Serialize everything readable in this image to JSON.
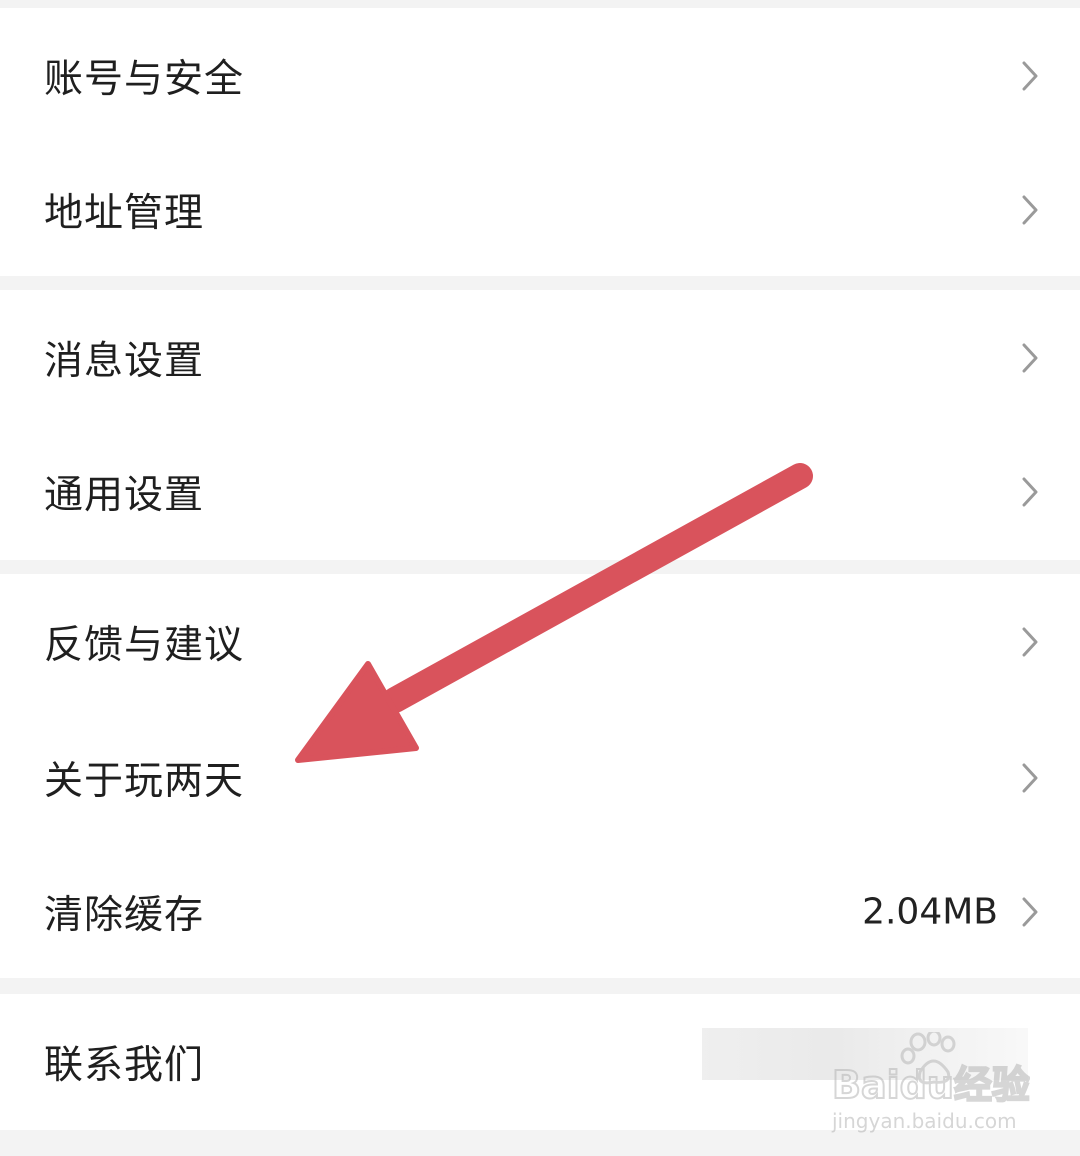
{
  "settings": {
    "groups": [
      {
        "items": [
          {
            "label": "账号与安全",
            "value": ""
          },
          {
            "label": "地址管理",
            "value": ""
          }
        ]
      },
      {
        "items": [
          {
            "label": "消息设置",
            "value": ""
          },
          {
            "label": "通用设置",
            "value": ""
          }
        ]
      },
      {
        "items": [
          {
            "label": "反馈与建议",
            "value": ""
          },
          {
            "label": "关于玩两天",
            "value": ""
          },
          {
            "label": "清除缓存",
            "value": "2.04MB"
          }
        ]
      },
      {
        "items": [
          {
            "label": "联系我们",
            "value": ""
          }
        ]
      }
    ]
  },
  "annotation": {
    "color": "#d9535c",
    "points_to": "关于玩两天"
  },
  "watermark": {
    "brand": "Baidu经验",
    "url": "jingyan.baidu.com"
  },
  "colors": {
    "page_background": "#f3f3f3",
    "row_background": "#ffffff",
    "text": "#1f1f1f",
    "chevron": "#9a9a9a"
  }
}
